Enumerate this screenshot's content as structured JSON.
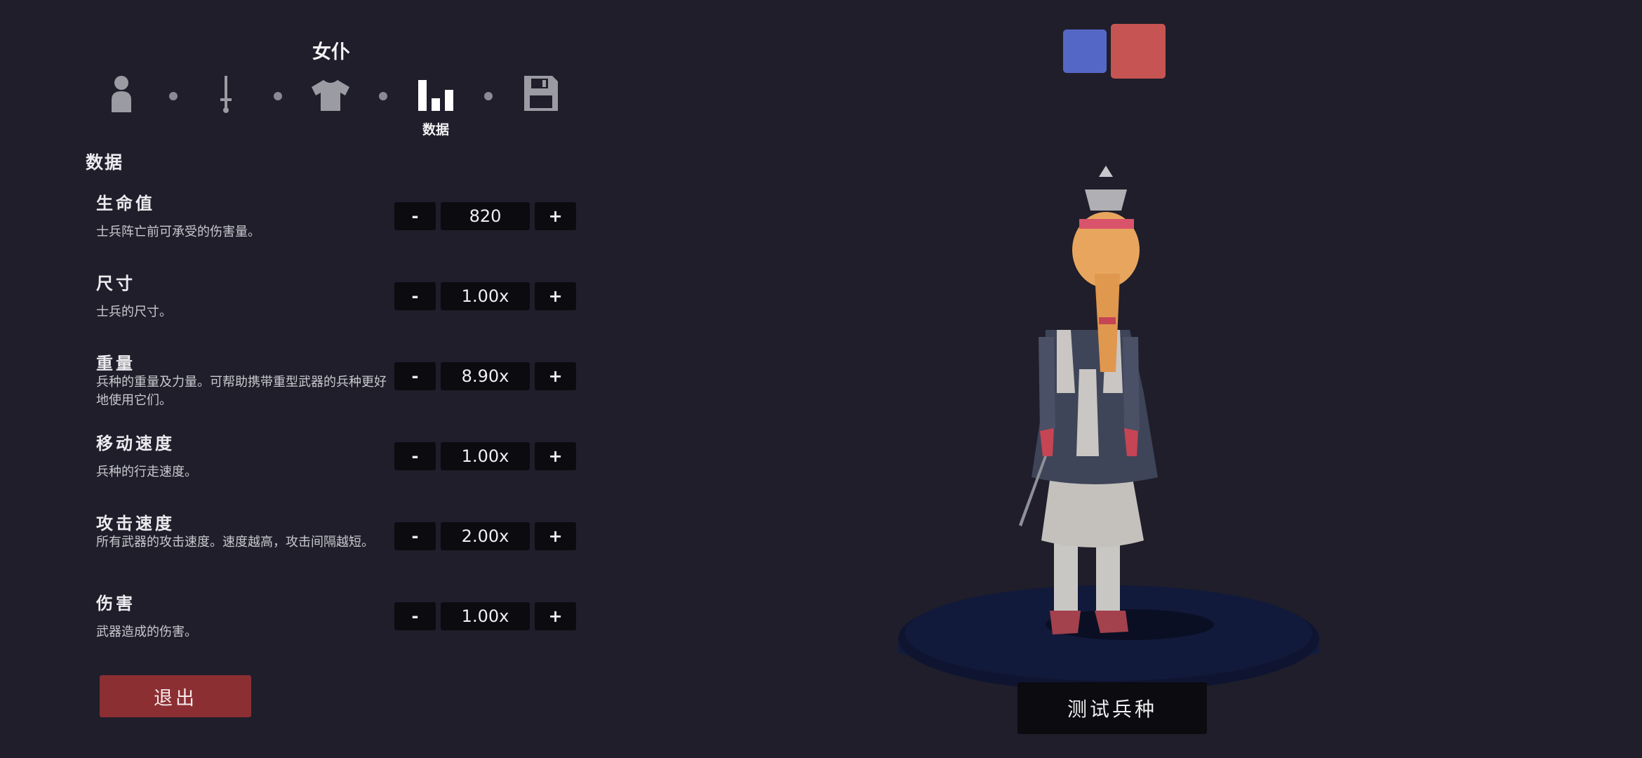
{
  "unit_name": "女仆",
  "nav": {
    "active_label": "数据",
    "items": [
      {
        "icon": "person-icon"
      },
      {
        "icon": "sword-icon"
      },
      {
        "icon": "shirt-icon"
      },
      {
        "icon": "stats-bars-icon",
        "label": "数据"
      },
      {
        "icon": "save-icon"
      }
    ]
  },
  "section_title": "数据",
  "stats": [
    {
      "name": "生命值",
      "desc": "士兵阵亡前可承受的伤害量。",
      "value": "820",
      "minus": "-",
      "plus": "+"
    },
    {
      "name": "尺寸",
      "desc": "士兵的尺寸。",
      "value": "1.00x",
      "minus": "-",
      "plus": "+"
    },
    {
      "name": "重量",
      "desc": "兵种的重量及力量。可帮助携带重型武器的兵种更好地使用它们。",
      "value": "8.90x",
      "minus": "-",
      "plus": "+"
    },
    {
      "name": "移动速度",
      "desc": "兵种的行走速度。",
      "value": "1.00x",
      "minus": "-",
      "plus": "+"
    },
    {
      "name": "攻击速度",
      "desc": "所有武器的攻击速度。速度越高，攻击间隔越短。",
      "value": "2.00x",
      "minus": "-",
      "plus": "+"
    },
    {
      "name": "伤害",
      "desc": "武器造成的伤害。",
      "value": "1.00x",
      "minus": "-",
      "plus": "+"
    }
  ],
  "exit_label": "退出",
  "test_label": "测试兵种",
  "colors": {
    "background": "#1f1e2a",
    "team_blue": "#5567c6",
    "team_red": "#c55453",
    "exit_button": "#8c2f33",
    "pedestal": "#101634"
  }
}
